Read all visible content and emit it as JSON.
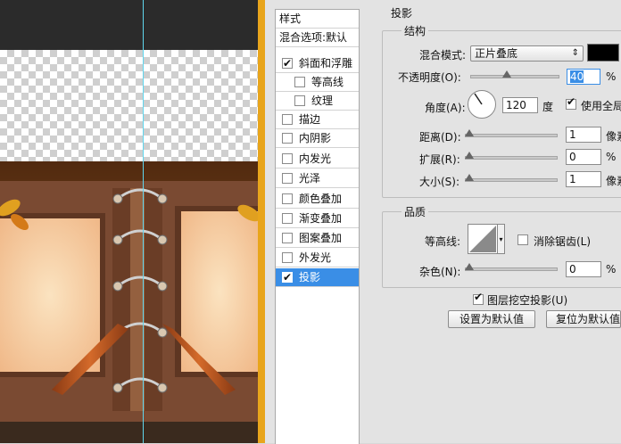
{
  "styles_panel": {
    "header": "样式",
    "blend_options": "混合选项:默认",
    "items": [
      {
        "label": "斜面和浮雕",
        "checked": true
      },
      {
        "label": "等高线",
        "checked": false
      },
      {
        "label": "纹理",
        "checked": false
      },
      {
        "label": "描边",
        "checked": false
      },
      {
        "label": "内阴影",
        "checked": false
      },
      {
        "label": "内发光",
        "checked": false
      },
      {
        "label": "光泽",
        "checked": false
      },
      {
        "label": "颜色叠加",
        "checked": false
      },
      {
        "label": "渐变叠加",
        "checked": false
      },
      {
        "label": "图案叠加",
        "checked": false
      },
      {
        "label": "外发光",
        "checked": false
      },
      {
        "label": "投影",
        "checked": true,
        "selected": true
      }
    ]
  },
  "drop_shadow": {
    "section_title": "投影",
    "structure": {
      "title": "结构",
      "blend_mode_label": "混合模式:",
      "blend_mode_value": "正片叠底",
      "shadow_color": "#000000",
      "opacity_label": "不透明度(O):",
      "opacity_value": "40",
      "opacity_unit": "%",
      "angle_label": "角度(A):",
      "angle_value": "120",
      "angle_unit": "度",
      "global_light_label": "使用全局光",
      "global_light_checked": true,
      "distance_label": "距离(D):",
      "distance_value": "1",
      "distance_unit": "像素",
      "spread_label": "扩展(R):",
      "spread_value": "0",
      "spread_unit": "%",
      "size_label": "大小(S):",
      "size_value": "1",
      "size_unit": "像素"
    },
    "quality": {
      "title": "品质",
      "contour_label": "等高线:",
      "antialias_label": "消除锯齿(L)",
      "antialias_checked": false,
      "noise_label": "杂色(N):",
      "noise_value": "0",
      "noise_unit": "%"
    },
    "knockout_label": "图层挖空投影(U)",
    "knockout_checked": true,
    "set_default_button": "设置为默认值",
    "reset_default_button": "复位为默认值"
  },
  "colors": {
    "accent": "#3a8ee6",
    "divider": "#e8a51c",
    "guide": "#5fd6ee"
  }
}
